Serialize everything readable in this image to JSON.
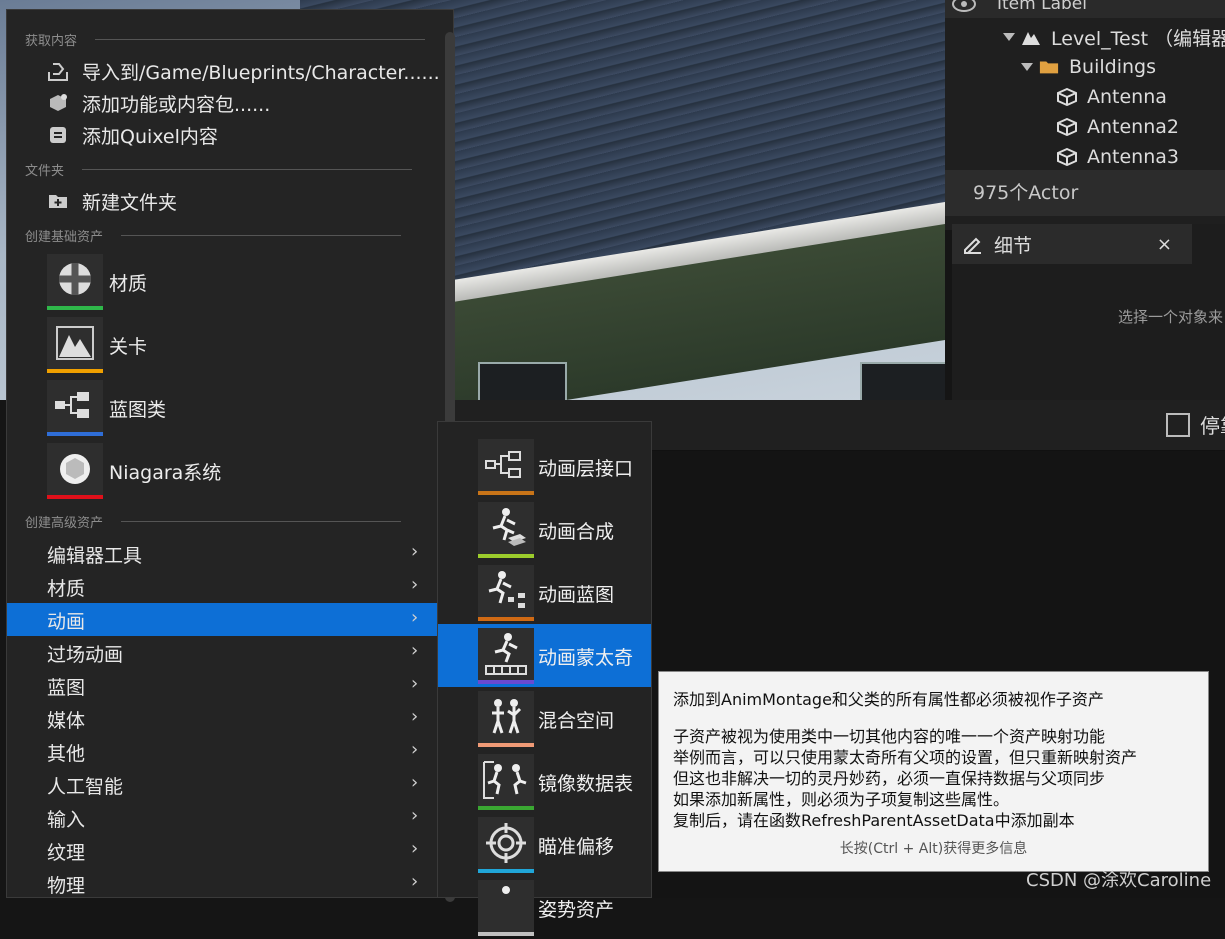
{
  "outliner": {
    "header_label": "Item Label",
    "rows": [
      {
        "label": "Level_Test （编辑器"
      },
      {
        "label": "Buildings"
      },
      {
        "label": "Antenna"
      },
      {
        "label": "Antenna2"
      },
      {
        "label": "Antenna3"
      }
    ],
    "actor_count": "975个Actor"
  },
  "details": {
    "tab_label": "细节",
    "close": "×",
    "empty_text": "选择一个对象来"
  },
  "dock": {
    "label": "停靠"
  },
  "menu": {
    "sections": {
      "get_content": "获取内容",
      "folder": "文件夹",
      "basic_assets": "创建基础资产",
      "advanced_assets": "创建高级资产"
    },
    "get_content_items": [
      {
        "label": "导入到/Game/Blueprints/Character......",
        "icon": "import-icon"
      },
      {
        "label": "添加功能或内容包......",
        "icon": "content-pack-icon"
      },
      {
        "label": "添加Quixel内容",
        "icon": "quixel-icon"
      }
    ],
    "new_folder": "新建文件夹",
    "basic_assets": [
      {
        "label": "材质",
        "icon": "material-icon",
        "color": "#2fb84a"
      },
      {
        "label": "关卡",
        "icon": "level-icon",
        "color": "#f0a000"
      },
      {
        "label": "蓝图类",
        "icon": "blueprint-class-icon",
        "color": "#2f6ed8"
      },
      {
        "label": "Niagara系统",
        "icon": "niagara-icon",
        "color": "#e0101a"
      }
    ],
    "advanced_categories": [
      {
        "label": "编辑器工具"
      },
      {
        "label": "材质"
      },
      {
        "label": "动画",
        "selected": true
      },
      {
        "label": "过场动画"
      },
      {
        "label": "蓝图"
      },
      {
        "label": "媒体"
      },
      {
        "label": "其他"
      },
      {
        "label": "人工智能"
      },
      {
        "label": "输入"
      },
      {
        "label": "纹理"
      },
      {
        "label": "物理"
      }
    ],
    "chevron": "›"
  },
  "submenu": {
    "items": [
      {
        "label": "动画层接口",
        "icon": "anim-layer-interface-icon",
        "color": "#c87418"
      },
      {
        "label": "动画合成",
        "icon": "anim-composite-icon",
        "color": "#9ccc2c"
      },
      {
        "label": "动画蓝图",
        "icon": "anim-blueprint-icon",
        "color": "#d06a14"
      },
      {
        "label": "动画蒙太奇",
        "icon": "anim-montage-icon",
        "color": "#6a4ad0",
        "selected": true
      },
      {
        "label": "混合空间",
        "icon": "blend-space-icon",
        "color": "#f09a76"
      },
      {
        "label": "镜像数据表",
        "icon": "mirror-data-table-icon",
        "color": "#3aa832"
      },
      {
        "label": "瞄准偏移",
        "icon": "aim-offset-icon",
        "color": "#20a6d8"
      },
      {
        "label": "姿势资产",
        "icon": "pose-asset-icon",
        "color": "#c0c0c0"
      }
    ]
  },
  "tooltip": {
    "title": "添加到AnimMontage和父类的所有属性都必须被视作子资产",
    "lines": [
      "子资产被视为使用类中一切其他内容的唯一一个资产映射功能",
      "举例而言，可以只使用蒙太奇所有父项的设置，但只重新映射资产",
      "但这也非解决一切的灵丹妙药，必须一直保持数据与父项同步",
      "如果添加新属性，则必须为子项复制这些属性。",
      "复制后，请在函数RefreshParentAssetData中添加副本"
    ],
    "hint": "长按(Ctrl + Alt)获得更多信息"
  },
  "watermark": "CSDN @涂欢Caroline"
}
